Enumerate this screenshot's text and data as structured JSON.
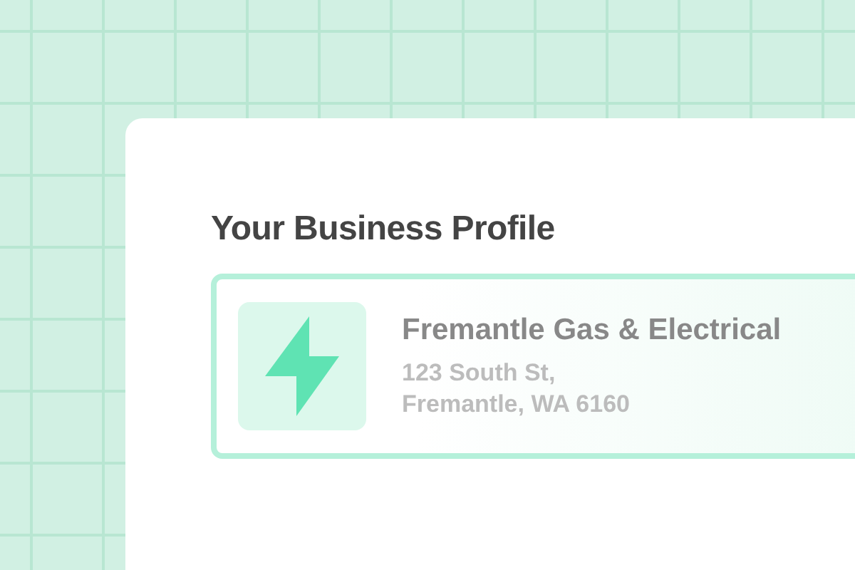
{
  "card": {
    "title": "Your Business Profile",
    "business": {
      "name": "Fremantle Gas & Electrical",
      "address_lines": [
        "123 South St,",
        "Fremantle, WA 6160"
      ]
    }
  }
}
